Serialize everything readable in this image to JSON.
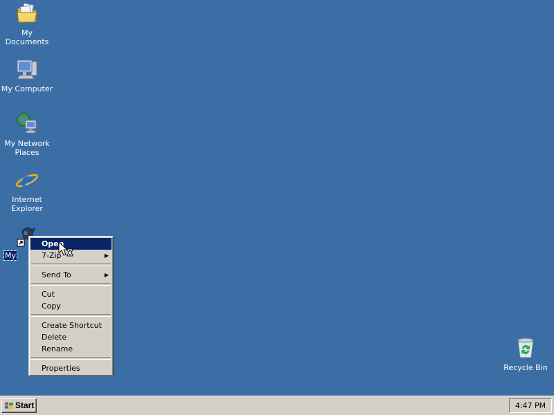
{
  "desktop": {
    "background": "#3a6ea5",
    "icons": [
      {
        "label": "My Documents",
        "icon": "folder-documents-icon"
      },
      {
        "label": "My Computer",
        "icon": "computer-icon"
      },
      {
        "label": "My Network\nPlaces",
        "icon": "network-places-icon"
      },
      {
        "label": "Internet\nExplorer",
        "icon": "internet-explorer-icon"
      },
      {
        "label": "My",
        "icon": "shortcut-icon"
      },
      {
        "label": "Recycle Bin",
        "icon": "recycle-bin-icon"
      }
    ]
  },
  "context_menu": {
    "items": [
      {
        "label": "Open",
        "highlighted": true
      },
      {
        "label": "7-Zip",
        "submenu": true
      },
      {
        "label": "Send To",
        "submenu": true
      },
      {
        "label": "Cut"
      },
      {
        "label": "Copy"
      },
      {
        "label": "Create Shortcut"
      },
      {
        "label": "Delete"
      },
      {
        "label": "Rename"
      },
      {
        "label": "Properties"
      }
    ]
  },
  "taskbar": {
    "start_label": "Start",
    "clock": "4:47 PM",
    "background": "#d4d0c8"
  },
  "colors": {
    "selection": "#0a246a"
  }
}
